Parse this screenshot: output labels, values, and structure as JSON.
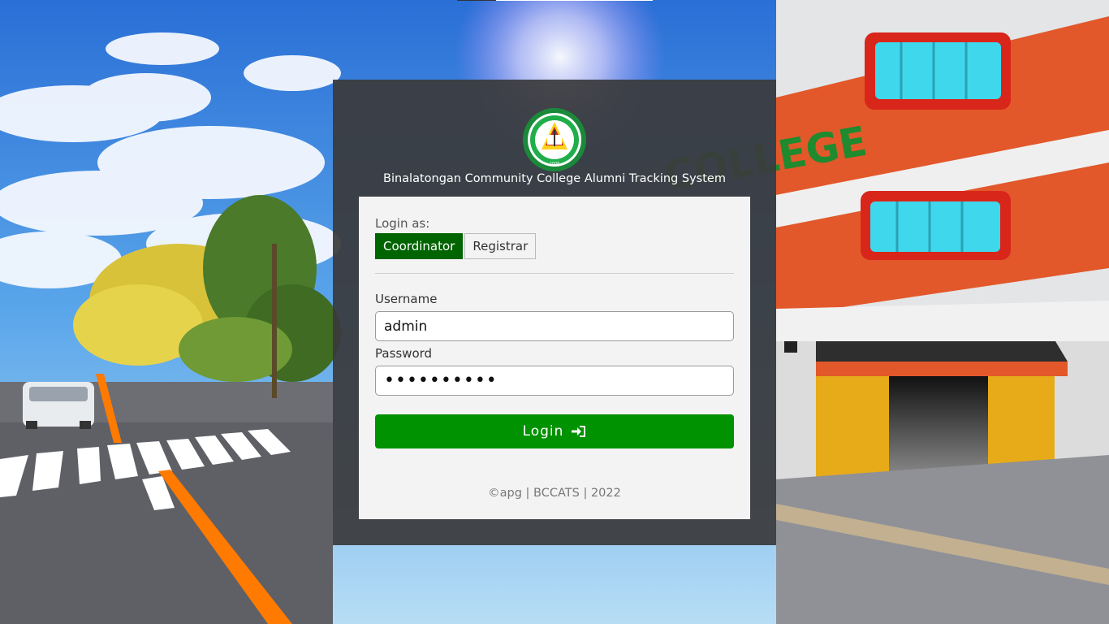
{
  "system": {
    "title": "Binalatongan Community College Alumni Tracking System",
    "logo_icon": "bcc-seal-logo",
    "logo_text": "BINALATONGAN COMMUNITY COLLEGE",
    "logo_year": "2006"
  },
  "background": {
    "sign_text": "COLLEGE"
  },
  "login": {
    "login_as_label": "Login as:",
    "roles": [
      {
        "label": "Coordinator",
        "selected": true
      },
      {
        "label": "Registrar",
        "selected": false
      }
    ],
    "username_label": "Username",
    "username_value": "admin",
    "password_label": "Password",
    "password_value": "••••••••••",
    "submit_label": "Login",
    "submit_icon": "sign-in-icon"
  },
  "footer": {
    "text": "©apg | BCCATS | 2022"
  },
  "colors": {
    "selected_role": "#006400",
    "login_button": "#009200",
    "panel": "#3a3a3c",
    "card": "#f3f3f3"
  }
}
